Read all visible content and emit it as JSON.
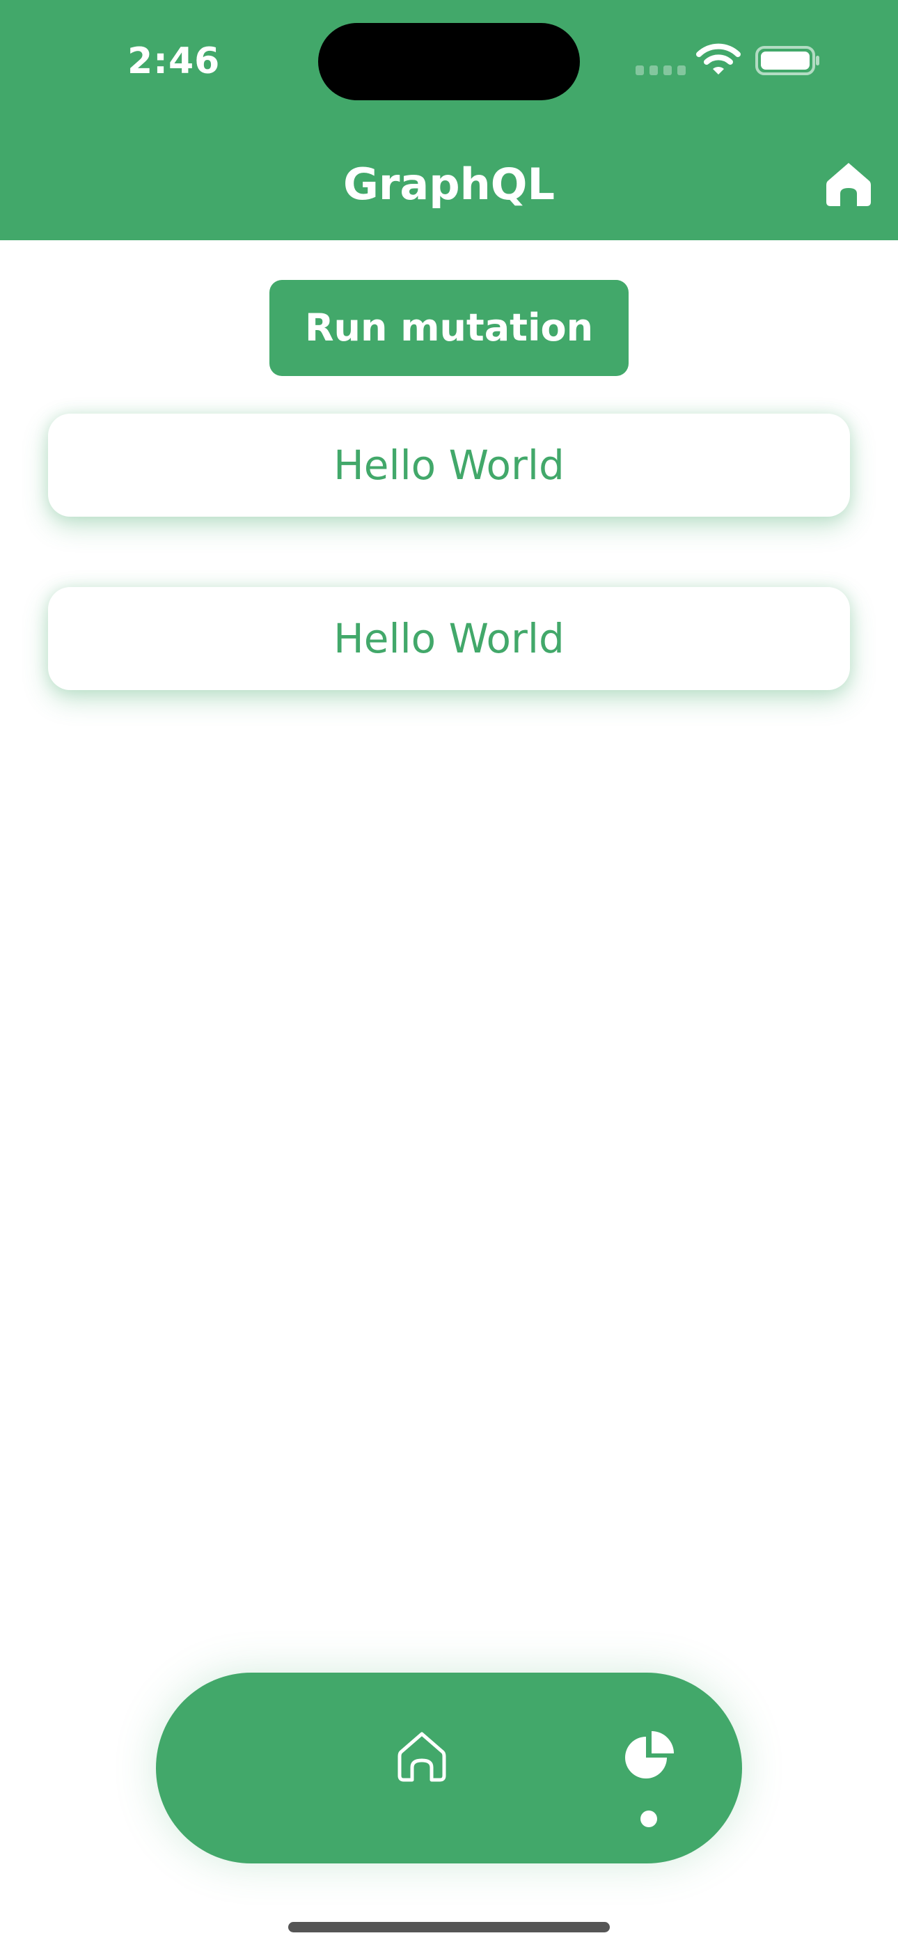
{
  "status_bar": {
    "time": "2:46"
  },
  "header": {
    "title": "GraphQL",
    "home_icon": "home-icon"
  },
  "main": {
    "run_button_label": "Run mutation",
    "results": [
      {
        "text": "Hello World"
      },
      {
        "text": "Hello World"
      }
    ]
  },
  "tab_bar": {
    "tabs": [
      {
        "icon": "home-outline-icon",
        "active": false
      },
      {
        "icon": "pie-chart-icon",
        "active": true
      }
    ]
  },
  "colors": {
    "accent": "#42a86a",
    "background": "#ffffff",
    "on_accent": "#ffffff"
  }
}
